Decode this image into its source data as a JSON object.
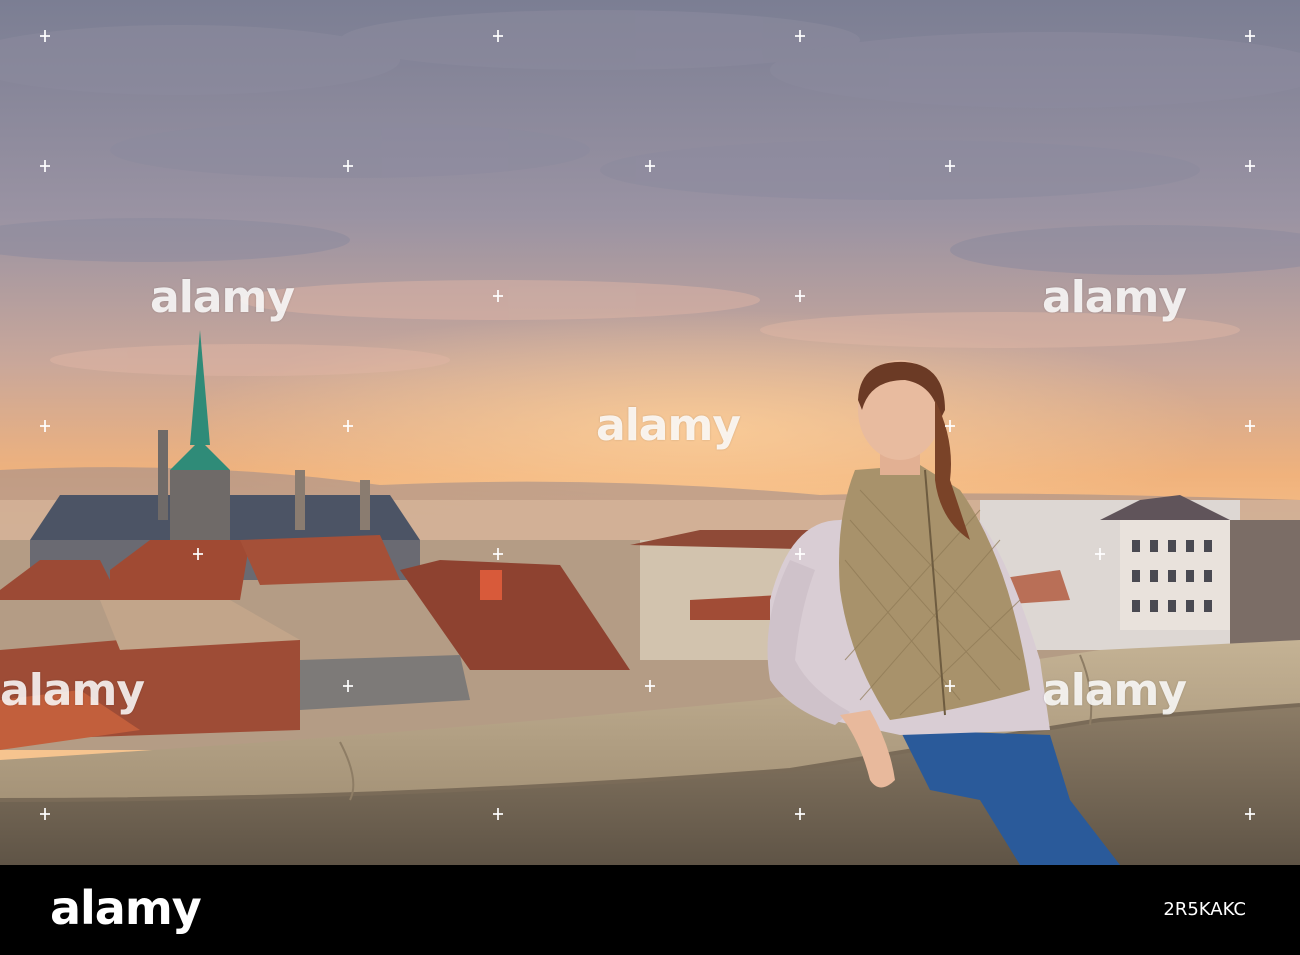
{
  "watermark": {
    "text": "alamy"
  },
  "footer": {
    "logo": "alamy",
    "image_id": "2R5KAKC"
  },
  "colors": {
    "sky_top": "#7b7e93",
    "sky_glow": "#f5b97a",
    "roof_red": "#9c4a35",
    "wall_stone": "#b9a78a",
    "vest": "#a8926b",
    "jeans": "#2a5a9a"
  }
}
